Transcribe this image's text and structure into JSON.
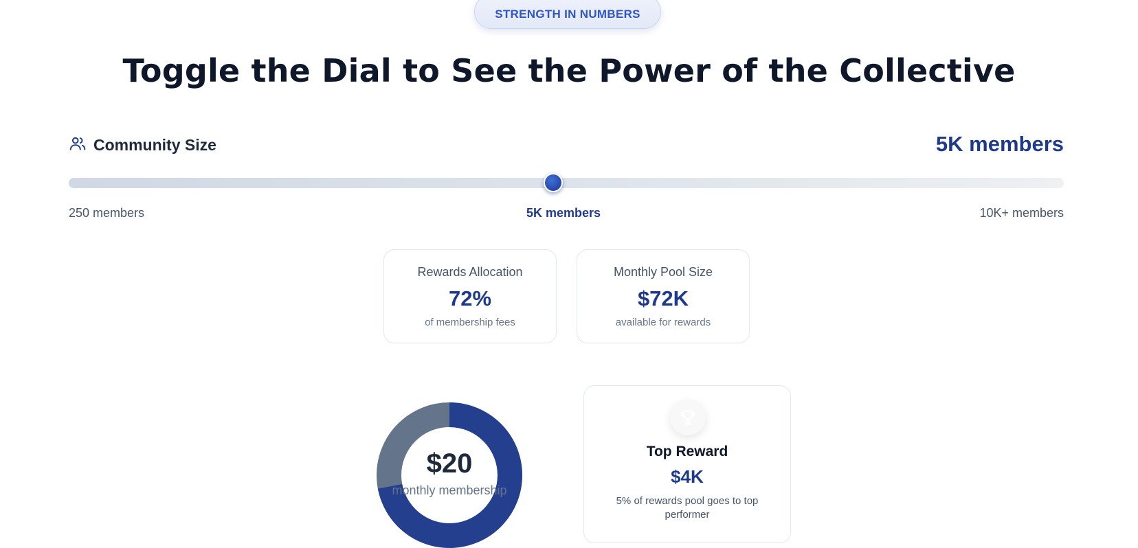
{
  "badge": {
    "label": "STRENGTH IN NUMBERS"
  },
  "headline": "Toggle the Dial to See the Power of the Collective",
  "community": {
    "icon": "users-icon",
    "label": "Community Size",
    "value_display": "5K members",
    "slider": {
      "value": 5000,
      "min": 250,
      "max": 10000,
      "fraction": 0.487,
      "min_label": "250 members",
      "mid_label": "5K members",
      "max_label": "10K+ members"
    }
  },
  "stats": [
    {
      "title": "Rewards Allocation",
      "value": "72%",
      "sub": "of membership fees"
    },
    {
      "title": "Monthly Pool Size",
      "value": "$72K",
      "sub": "available for rewards"
    }
  ],
  "membership": {
    "value": "$20",
    "label": "monthly membership",
    "ring_fraction_rewards": 0.72,
    "colors": {
      "rewards": "#253f8f",
      "remainder": "#64748b"
    }
  },
  "top_reward": {
    "icon": "trophy-icon",
    "title": "Top Reward",
    "value": "$4K",
    "description": "5% of rewards pool goes to top performer"
  },
  "colors": {
    "accent": "#1e3a8a",
    "badge_text": "#2f55c8"
  }
}
